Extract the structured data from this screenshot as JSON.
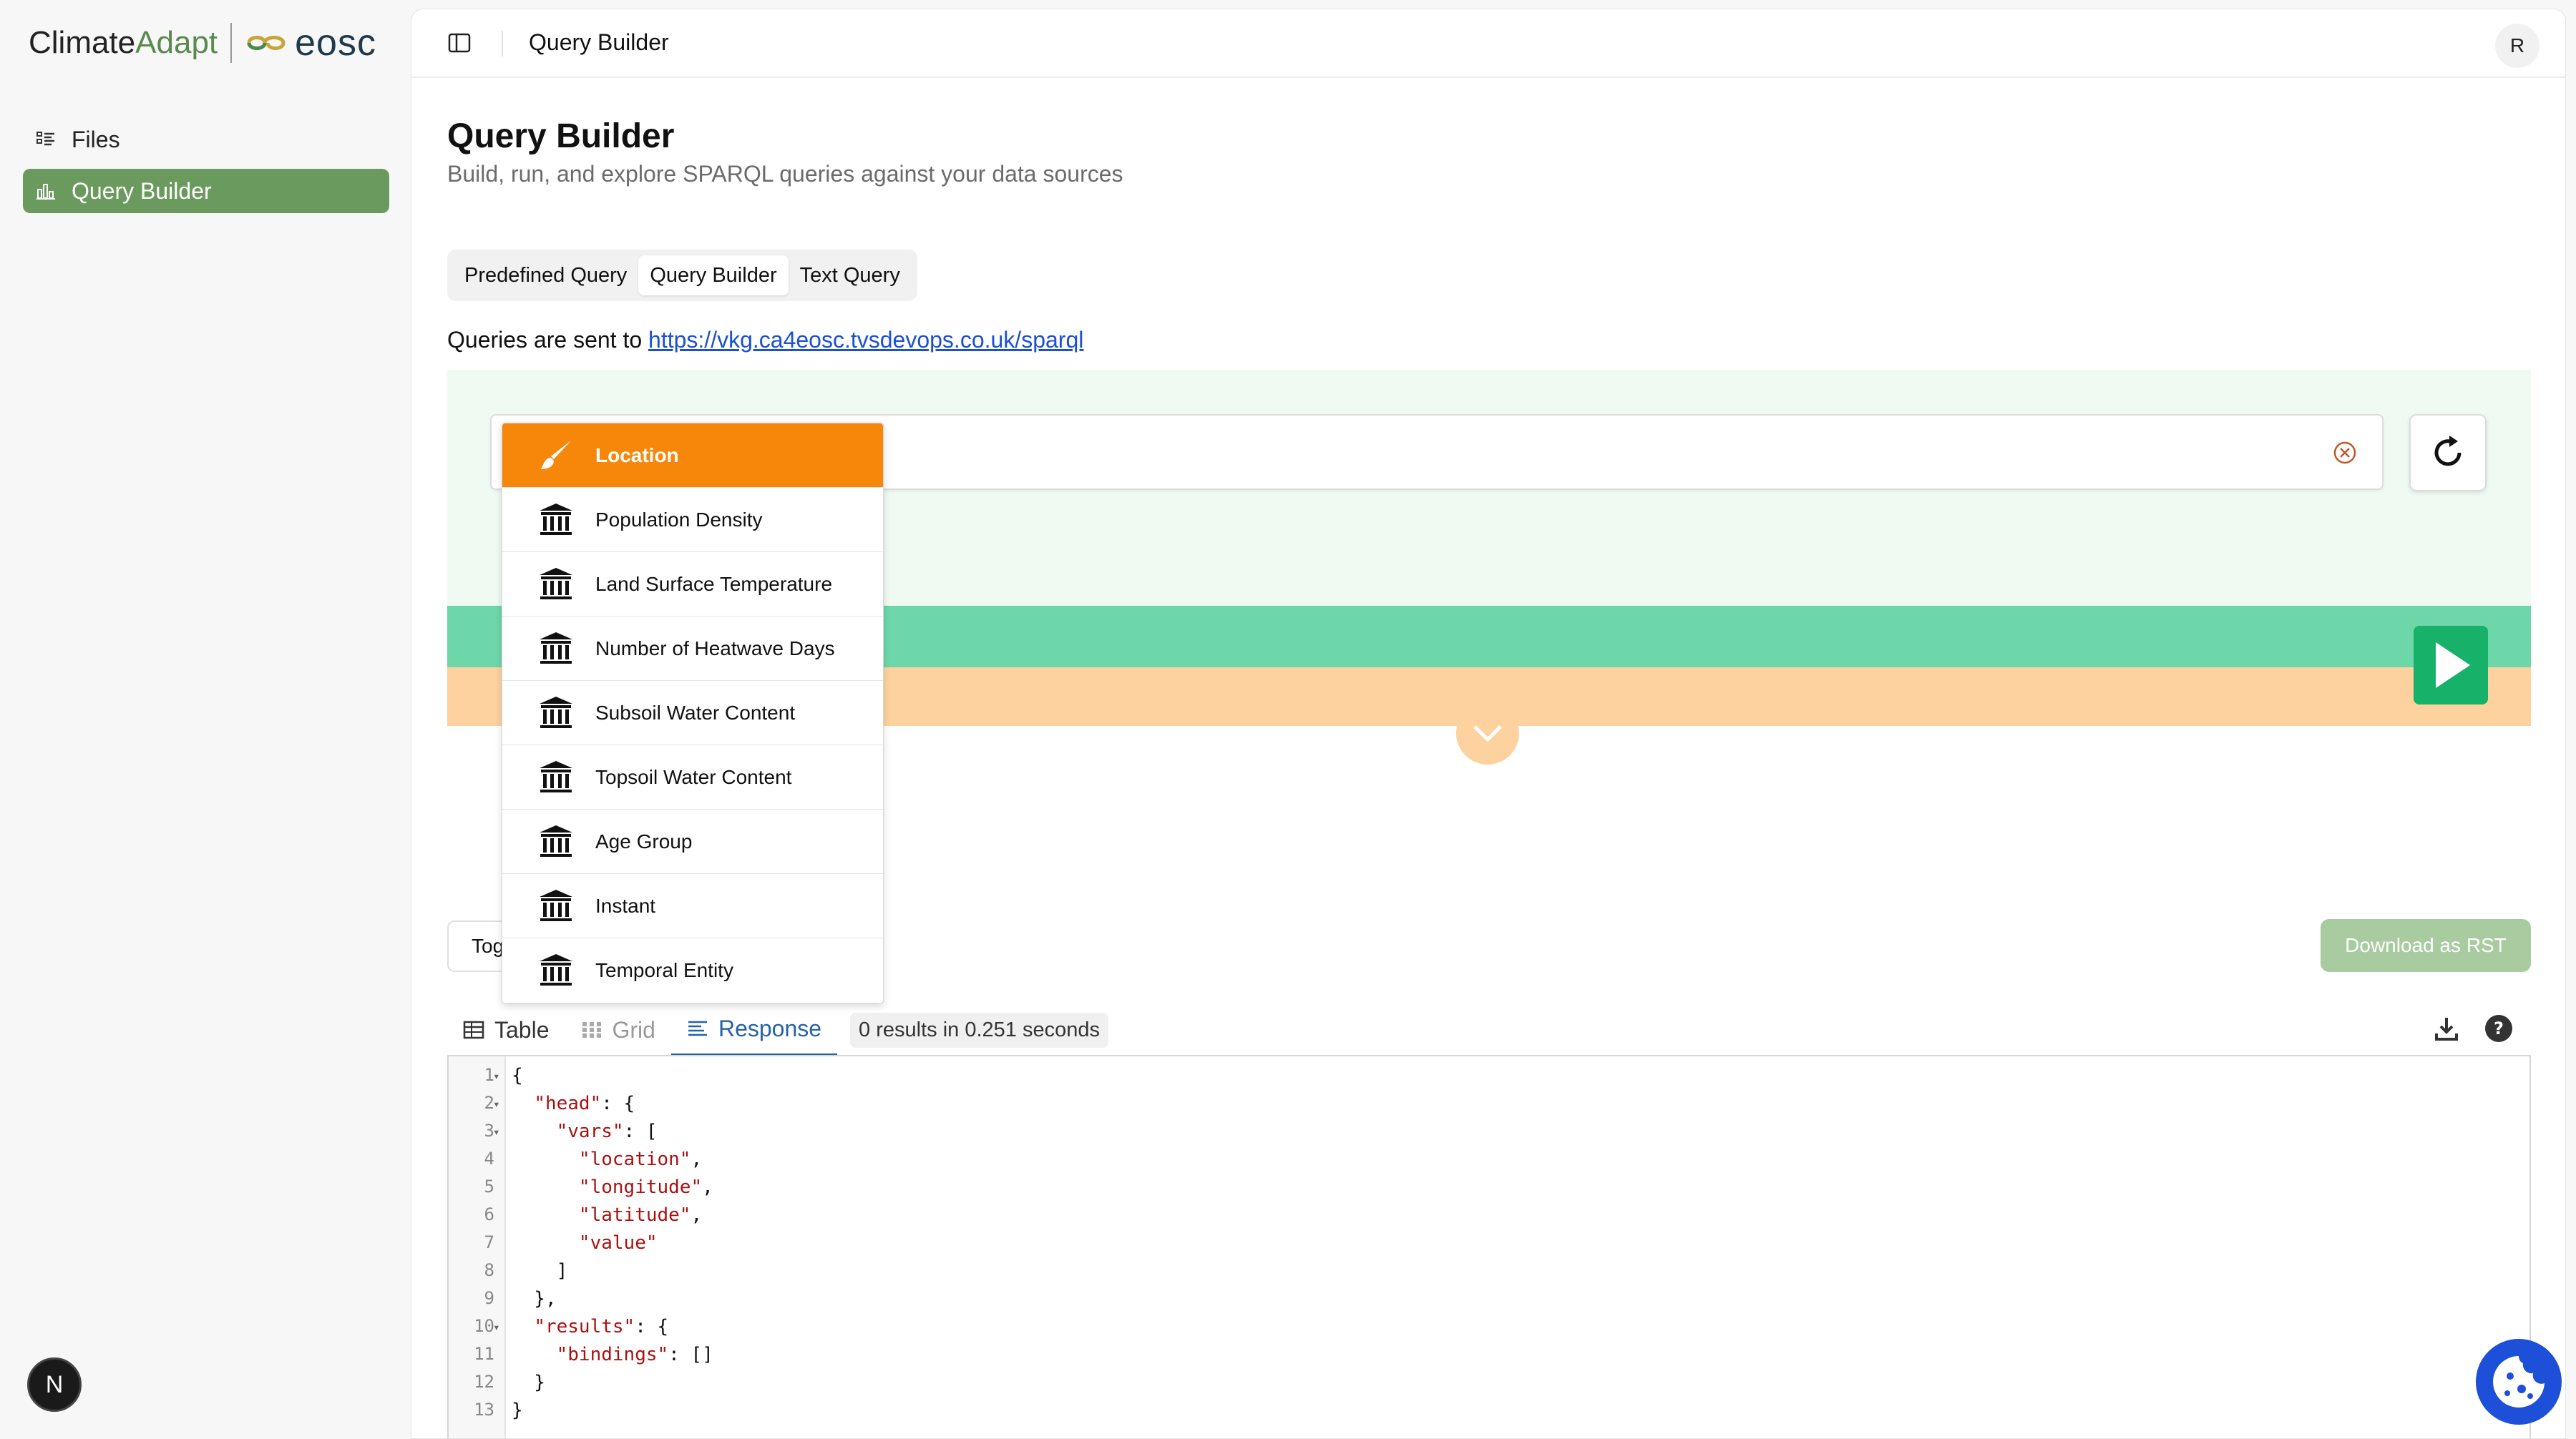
{
  "brand": {
    "part1": "Climate",
    "part2": "Adapt",
    "partner": "eosc"
  },
  "sidebar": {
    "items": [
      {
        "label": "Files",
        "icon": "list-icon"
      },
      {
        "label": "Query Builder",
        "icon": "chart-icon",
        "active": true
      }
    ]
  },
  "next_badge": "N",
  "topbar": {
    "title": "Query Builder",
    "avatar": "R"
  },
  "page": {
    "title": "Query Builder",
    "subtitle": "Build, run, and explore SPARQL queries against your data sources"
  },
  "tabs": [
    "Predefined Query",
    "Query Builder",
    "Text Query"
  ],
  "endpoint": {
    "prefix": "Queries are sent to ",
    "url": "https://vkg.ca4eosc.tvsdevops.co.uk/sparql"
  },
  "dropdown": {
    "items": [
      {
        "label": "Location",
        "icon": "brush-icon",
        "selected": true
      },
      {
        "label": "Population Density",
        "icon": "institution-icon"
      },
      {
        "label": "Land Surface Temperature",
        "icon": "institution-icon"
      },
      {
        "label": "Number of Heatwave Days",
        "icon": "institution-icon"
      },
      {
        "label": "Subsoil Water Content",
        "icon": "institution-icon"
      },
      {
        "label": "Topsoil Water Content",
        "icon": "institution-icon"
      },
      {
        "label": "Age Group",
        "icon": "institution-icon"
      },
      {
        "label": "Instant",
        "icon": "institution-icon"
      },
      {
        "label": "Temporal Entity",
        "icon": "institution-icon"
      }
    ]
  },
  "toggle_button": "Tog",
  "download_button": "Download as RST",
  "result_tabs": {
    "table": "Table",
    "grid": "Grid",
    "response": "Response",
    "count": "0 results in 0.251 seconds"
  },
  "colors": {
    "accent_green": "#6a9a5d",
    "orange": "#f7870a",
    "play_green": "#17b169",
    "link_blue": "#1a4fd6"
  },
  "code": {
    "lines": [
      {
        "n": "1",
        "fold": true,
        "text": "{"
      },
      {
        "n": "2",
        "fold": true,
        "text": "  \"head\": {"
      },
      {
        "n": "3",
        "fold": true,
        "text": "    \"vars\": ["
      },
      {
        "n": "4",
        "fold": false,
        "text": "      \"location\","
      },
      {
        "n": "5",
        "fold": false,
        "text": "      \"longitude\","
      },
      {
        "n": "6",
        "fold": false,
        "text": "      \"latitude\","
      },
      {
        "n": "7",
        "fold": false,
        "text": "      \"value\""
      },
      {
        "n": "8",
        "fold": false,
        "text": "    ]"
      },
      {
        "n": "9",
        "fold": false,
        "text": "  },"
      },
      {
        "n": "10",
        "fold": true,
        "text": "  \"results\": {"
      },
      {
        "n": "11",
        "fold": false,
        "text": "    \"bindings\": []"
      },
      {
        "n": "12",
        "fold": false,
        "text": "  }"
      },
      {
        "n": "13",
        "fold": false,
        "text": "}"
      }
    ]
  }
}
